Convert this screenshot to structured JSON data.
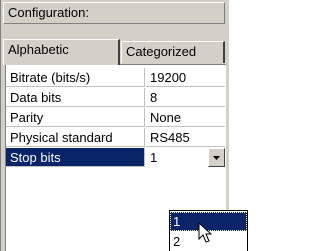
{
  "header": {
    "title": "Configuration:"
  },
  "tabs": [
    {
      "label": "Alphabetic",
      "active": true
    },
    {
      "label": "Categorized",
      "active": false
    }
  ],
  "properties": [
    {
      "name": "Bitrate (bits/s)",
      "value": "19200"
    },
    {
      "name": "Data bits",
      "value": "8"
    },
    {
      "name": "Parity",
      "value": "None"
    },
    {
      "name": "Physical standard",
      "value": "RS485"
    }
  ],
  "selected": {
    "name": "Stop bits",
    "value": "1"
  },
  "dropdown": {
    "options": [
      "1",
      "2"
    ],
    "highlighted": "1"
  },
  "colors": {
    "selection": "#0a246a",
    "face": "#d4d0c8"
  },
  "icons": {
    "dropdown": "chevron-down-icon",
    "cursor": "mouse-pointer-icon"
  }
}
